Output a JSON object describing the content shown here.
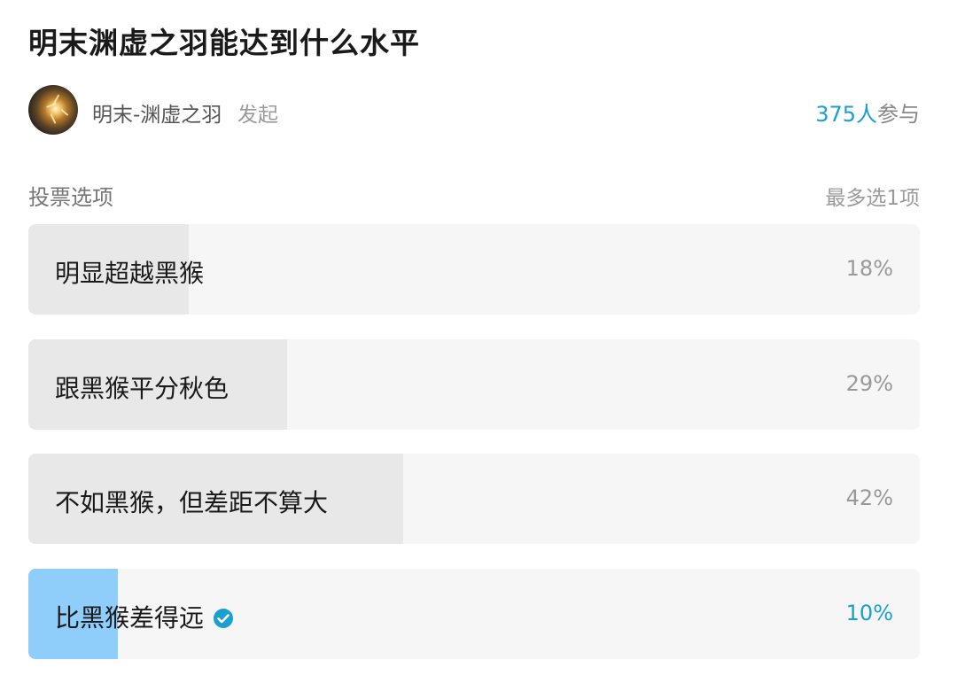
{
  "poll": {
    "title": "明末渊虚之羽能达到什么水平",
    "author": {
      "name": "明末-渊虚之羽",
      "action": "发起",
      "avatar_icon": "avatar-image"
    },
    "participants": {
      "count": "375人",
      "suffix": "参与"
    },
    "section_label": "投票选项",
    "selection_rule": "最多选1项",
    "options": [
      {
        "label": "明显超越黑猴",
        "percent": "18%",
        "share": 0.18,
        "selected": false
      },
      {
        "label": "跟黑猴平分秋色",
        "percent": "29%",
        "share": 0.29,
        "selected": false
      },
      {
        "label": "不如黑猴，但差距不算大",
        "percent": "42%",
        "share": 0.42,
        "selected": false
      },
      {
        "label": "比黑猴差得远",
        "percent": "10%",
        "share": 0.1,
        "selected": true,
        "selected_icon": "check-circle-icon"
      }
    ],
    "colors": {
      "accent": "#1a9fd0",
      "selected_fill": "#8fcdfa",
      "bar_fill": "#e8e8e8",
      "bar_background": "#f6f6f6"
    }
  }
}
